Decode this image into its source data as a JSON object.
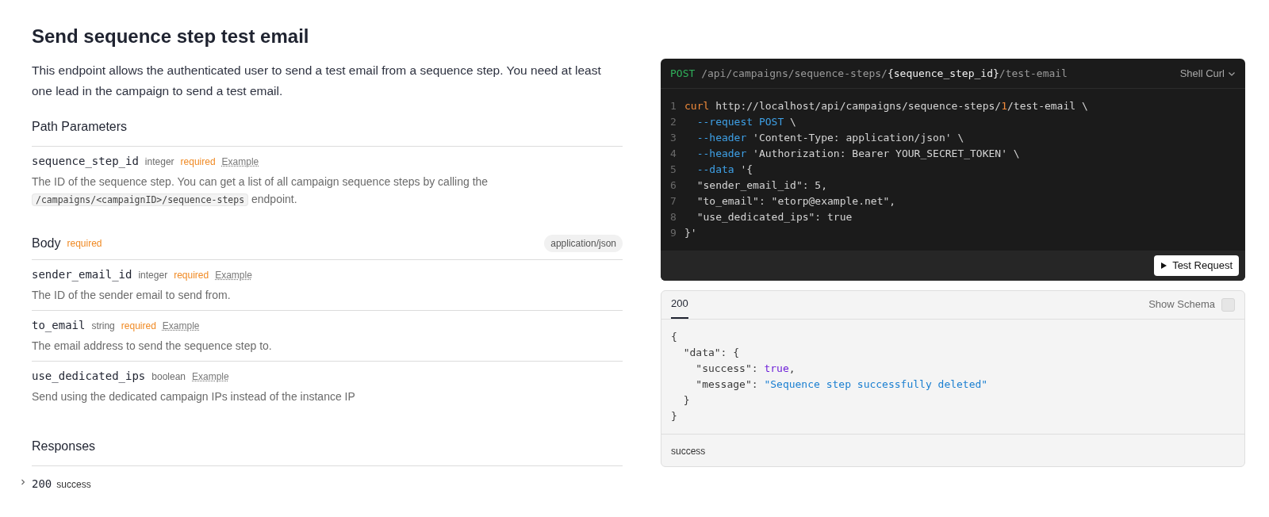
{
  "title": "Send sequence step test email",
  "description": "This endpoint allows the authenticated user to send a test email from a sequence step. You need at least one lead in the campaign to send a test email.",
  "path_parameters": {
    "heading": "Path Parameters",
    "params": [
      {
        "name": "sequence_step_id",
        "type": "integer",
        "required": "required",
        "example": "Example",
        "description": [
          {
            "kind": "text",
            "text": "The ID of the sequence step. You can get a list of all campaign sequence steps by calling the "
          },
          {
            "kind": "code",
            "text": "/campaigns/<campaignID>/sequence-steps"
          },
          {
            "kind": "text",
            "text": " endpoint."
          }
        ]
      }
    ]
  },
  "body": {
    "heading": "Body",
    "required": "required",
    "content_type": "application/json",
    "params": [
      {
        "name": "sender_email_id",
        "type": "integer",
        "required": "required",
        "example": "Example",
        "description": [
          {
            "kind": "text",
            "text": "The ID of the sender email to send from."
          }
        ]
      },
      {
        "name": "to_email",
        "type": "string",
        "required": "required",
        "example": "Example",
        "description": [
          {
            "kind": "text",
            "text": "The email address to send the sequence step to."
          }
        ]
      },
      {
        "name": "use_dedicated_ips",
        "type": "boolean",
        "example": "Example",
        "description": [
          {
            "kind": "text",
            "text": "Send using the dedicated campaign IPs instead of the instance IP"
          }
        ]
      }
    ]
  },
  "responses": {
    "heading": "Responses",
    "items": [
      {
        "code": "200",
        "label": "success",
        "expanded": false
      }
    ]
  },
  "request": {
    "method": "POST",
    "path": [
      {
        "kind": "plain",
        "text": "/api/campaigns/sequence-steps/"
      },
      {
        "kind": "param",
        "text": "{sequence_step_id}"
      },
      {
        "kind": "plain",
        "text": "/test-email"
      }
    ],
    "language": "Shell Curl",
    "lines": [
      {
        "number": "1",
        "tokens": [
          {
            "kind": "keyword",
            "text": "curl"
          },
          {
            "kind": "plain",
            "text": " http://localhost/api/campaigns/sequence-steps/"
          },
          {
            "kind": "number",
            "text": "1"
          },
          {
            "kind": "plain",
            "text": "/test-email \\"
          }
        ]
      },
      {
        "number": "2",
        "tokens": [
          {
            "kind": "flag",
            "text": "  --request POST"
          },
          {
            "kind": "plain",
            "text": " \\"
          }
        ]
      },
      {
        "number": "3",
        "tokens": [
          {
            "kind": "flag",
            "text": "  --header"
          },
          {
            "kind": "plain",
            "text": " 'Content-Type: application/json' \\"
          }
        ]
      },
      {
        "number": "4",
        "tokens": [
          {
            "kind": "flag",
            "text": "  --header"
          },
          {
            "kind": "plain",
            "text": " 'Authorization: Bearer YOUR_SECRET_TOKEN' \\"
          }
        ]
      },
      {
        "number": "5",
        "tokens": [
          {
            "kind": "flag",
            "text": "  --data"
          },
          {
            "kind": "plain",
            "text": " '{"
          }
        ]
      },
      {
        "number": "6",
        "tokens": [
          {
            "kind": "plain",
            "text": "  \"sender_email_id\": 5,"
          }
        ]
      },
      {
        "number": "7",
        "tokens": [
          {
            "kind": "plain",
            "text": "  \"to_email\": \"etorp@example.net\","
          }
        ]
      },
      {
        "number": "8",
        "tokens": [
          {
            "kind": "plain",
            "text": "  \"use_dedicated_ips\": true"
          }
        ]
      },
      {
        "number": "9",
        "tokens": [
          {
            "kind": "plain",
            "text": "}'"
          }
        ]
      }
    ],
    "button": "Test Request"
  },
  "response": {
    "tabs": [
      {
        "label": "200",
        "selected": true
      }
    ],
    "show_schema": {
      "label": "Show Schema",
      "checked": false
    },
    "lines": [
      {
        "tokens": [
          {
            "kind": "plain",
            "text": "{"
          }
        ]
      },
      {
        "tokens": [
          {
            "kind": "plain",
            "text": "  \"data\": {"
          }
        ]
      },
      {
        "tokens": [
          {
            "kind": "plain",
            "text": "    \"success\": "
          },
          {
            "kind": "bool",
            "text": "true"
          },
          {
            "kind": "plain",
            "text": ","
          }
        ]
      },
      {
        "tokens": [
          {
            "kind": "plain",
            "text": "    \"message\": "
          },
          {
            "kind": "string",
            "text": "\"Sequence step successfully deleted\""
          }
        ]
      },
      {
        "tokens": [
          {
            "kind": "plain",
            "text": "  }"
          }
        ]
      },
      {
        "tokens": [
          {
            "kind": "plain",
            "text": "}"
          }
        ]
      }
    ],
    "footer": "success"
  }
}
